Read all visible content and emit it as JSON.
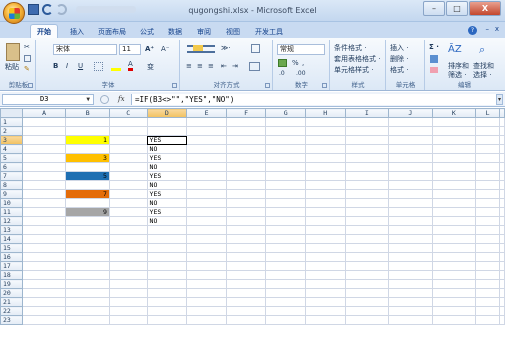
{
  "window": {
    "title": "qugongshi.xlsx - Microsoft Excel",
    "controls": [
      "–",
      "□",
      "X"
    ]
  },
  "tabs": [
    {
      "label": "开始",
      "active": true
    },
    {
      "label": "插入"
    },
    {
      "label": "页面布局"
    },
    {
      "label": "公式"
    },
    {
      "label": "数据"
    },
    {
      "label": "审阅"
    },
    {
      "label": "视图"
    },
    {
      "label": "开发工具"
    }
  ],
  "ribbon": {
    "clipboard": {
      "label": "剪贴板",
      "paste": "粘贴"
    },
    "font": {
      "label": "字体",
      "name": "宋体",
      "size": "11",
      "grow": "A⁺",
      "shrink": "A⁻",
      "bold": "B",
      "italic": "I",
      "underline": "U",
      "font_color_letter": "A",
      "phonetic": "变"
    },
    "alignment": {
      "label": "对齐方式"
    },
    "number": {
      "label": "数字",
      "format": "常规",
      "percent": "%",
      "comma": ",",
      "inc": ".0",
      "dec": ".00"
    },
    "styles": {
      "label": "样式",
      "conditional": "条件格式 ·",
      "table_format": "套用表格格式 ·",
      "cell_styles": "单元格样式 ·"
    },
    "cells": {
      "label": "单元格",
      "insert": "插入 ·",
      "delete": "删除 ·",
      "format": "格式 ·"
    },
    "editing": {
      "label": "编辑",
      "sigma": "Σ ·",
      "sort": "排序和",
      "sort2": "筛选 ·",
      "find": "查找和",
      "find2": "选择 ·"
    }
  },
  "formula_bar": {
    "name_box": "D3",
    "fx": "fx",
    "formula": "=IF(B3<>\"\",\"YES\",\"NO\")"
  },
  "sheet": {
    "columns": [
      "A",
      "B",
      "C",
      "D",
      "E",
      "F",
      "G",
      "H",
      "I",
      "J",
      "K",
      "L"
    ],
    "active_column": "D",
    "active_row": "3",
    "rows": [
      {
        "n": "1",
        "b": "",
        "d": ""
      },
      {
        "n": "2",
        "b": "",
        "d": ""
      },
      {
        "n": "3",
        "b": "1",
        "d": "YES"
      },
      {
        "n": "4",
        "b": "",
        "d": "NO"
      },
      {
        "n": "5",
        "b": "3",
        "d": "YES"
      },
      {
        "n": "6",
        "b": "",
        "d": "NO"
      },
      {
        "n": "7",
        "b": "5",
        "d": "YES"
      },
      {
        "n": "8",
        "b": "",
        "d": "NO"
      },
      {
        "n": "9",
        "b": "7",
        "d": "YES"
      },
      {
        "n": "10",
        "b": "",
        "d": "NO"
      },
      {
        "n": "11",
        "b": "9",
        "d": "YES"
      },
      {
        "n": "12",
        "b": "",
        "d": "NO"
      },
      {
        "n": "13",
        "b": "",
        "d": ""
      },
      {
        "n": "14",
        "b": "",
        "d": ""
      },
      {
        "n": "15",
        "b": "",
        "d": ""
      },
      {
        "n": "16",
        "b": "",
        "d": ""
      },
      {
        "n": "17",
        "b": "",
        "d": ""
      },
      {
        "n": "18",
        "b": "",
        "d": ""
      },
      {
        "n": "19",
        "b": "",
        "d": ""
      },
      {
        "n": "20",
        "b": "",
        "d": ""
      },
      {
        "n": "21",
        "b": "",
        "d": ""
      },
      {
        "n": "22",
        "b": "",
        "d": ""
      },
      {
        "n": "23",
        "b": "",
        "d": ""
      }
    ],
    "cell_fills": {
      "3": "#ffff00",
      "5": "#ffc000",
      "7": "#1f6fb2",
      "9": "#e46c0a",
      "11": "#a6a6a6"
    }
  }
}
